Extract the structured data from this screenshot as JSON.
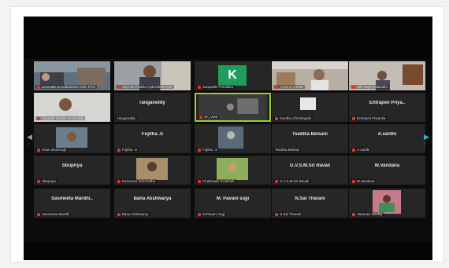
{
  "nav": {
    "prev_icon": "◀",
    "next_icon": "▶",
    "prev_page": "1",
    "next_page": "2"
  },
  "tiles": [
    {
      "center": "",
      "label": "Somnath M Sadasivam Asst. Prof."
    },
    {
      "center": "",
      "label": "Jaymant Naidu Hyderabad Asst."
    },
    {
      "center": "",
      "label": "Sarapathi Pravalika"
    },
    {
      "center": "",
      "label": "Aravind Kumar"
    },
    {
      "center": "",
      "label": "Wifi Raju Kolawathi"
    },
    {
      "center": "",
      "label": "Sasanth Reddy Vemireddy"
    },
    {
      "center": "rangareddy",
      "label": "rangareddy"
    },
    {
      "center": "",
      "label": "Sri_Vutti"
    },
    {
      "center": "",
      "label": "Kavitha Chinthapalli"
    },
    {
      "center": "Entrapeli Priya..",
      "label": "Entrapeli Priyanka"
    },
    {
      "center": "",
      "label": "Kiran Dharmajit"
    },
    {
      "center": "Fujitha .S",
      "label": "Fujitha .S"
    },
    {
      "center": "",
      "label": "Fujitha .S"
    },
    {
      "center": "Tsedika Belsani",
      "label": "Tsedika Belsani"
    },
    {
      "center": "A.xanthi",
      "label": "A.xanthi"
    },
    {
      "center": "Sbupriya",
      "label": "Sbupriya"
    },
    {
      "center": "",
      "label": "Nazeema Seemaitha"
    },
    {
      "center": "",
      "label": "Chathrada Swathish"
    },
    {
      "center": "G.V.S.M.Sri Ravali",
      "label": "G.V.S.M.Sri Ravali"
    },
    {
      "center": "M.Vandana",
      "label": "M.Vandana"
    },
    {
      "center": "Sasmeeta  Mardhi..",
      "label": "Sasmeeta Mardhi"
    },
    {
      "center": "Bana Akshwarya",
      "label": "Bana Akshwarya"
    },
    {
      "center": "M. Pavani sujji",
      "label": "M.Pavani Sujji"
    },
    {
      "center": "N.Sai Tharani",
      "label": "N.Sai Tharani"
    },
    {
      "center": "",
      "label": "Varanasi Doubly"
    }
  ]
}
